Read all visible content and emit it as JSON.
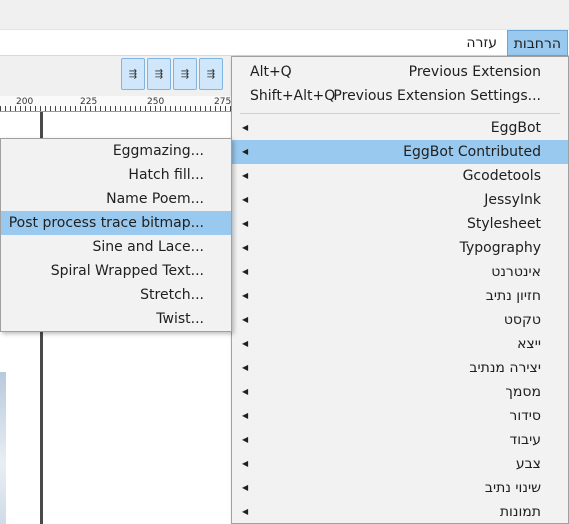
{
  "menubar": {
    "help_label": "עזרה",
    "extensions_label": "הרחבות"
  },
  "ruler": {
    "ticks": [
      "200",
      "225",
      "250",
      "275"
    ]
  },
  "toolbar": {
    "buttons": [
      "align-1",
      "align-2",
      "align-3",
      "align-4"
    ]
  },
  "extensions_menu": {
    "recent": [
      {
        "label": "Previous Extension",
        "accel": "Alt+Q"
      },
      {
        "label": "Previous Extension Settings...",
        "accel": "Shift+Alt+Q"
      }
    ],
    "items": [
      {
        "label": "EggBot"
      },
      {
        "label": "EggBot Contributed"
      },
      {
        "label": "Gcodetools"
      },
      {
        "label": "JessyInk"
      },
      {
        "label": "Stylesheet"
      },
      {
        "label": "Typography"
      },
      {
        "label": "אינטרנט"
      },
      {
        "label": "חזיון נתיב"
      },
      {
        "label": "טקסט"
      },
      {
        "label": "ייצא"
      },
      {
        "label": "יצירה מנתיב"
      },
      {
        "label": "מסמך"
      },
      {
        "label": "סידור"
      },
      {
        "label": "עיבוד"
      },
      {
        "label": "צבע"
      },
      {
        "label": "שינוי נתיב"
      },
      {
        "label": "תמונות"
      }
    ]
  },
  "submenu": {
    "items": [
      {
        "label": "Eggmazing..."
      },
      {
        "label": "Hatch fill..."
      },
      {
        "label": "Name Poem..."
      },
      {
        "label": "Post process trace bitmap..."
      },
      {
        "label": "Sine and Lace..."
      },
      {
        "label": "Spiral Wrapped Text..."
      },
      {
        "label": "Stretch..."
      },
      {
        "label": "Twist..."
      }
    ]
  },
  "colors": {
    "highlight": "#99c9ef",
    "menu_bg": "#f2f2f2"
  }
}
